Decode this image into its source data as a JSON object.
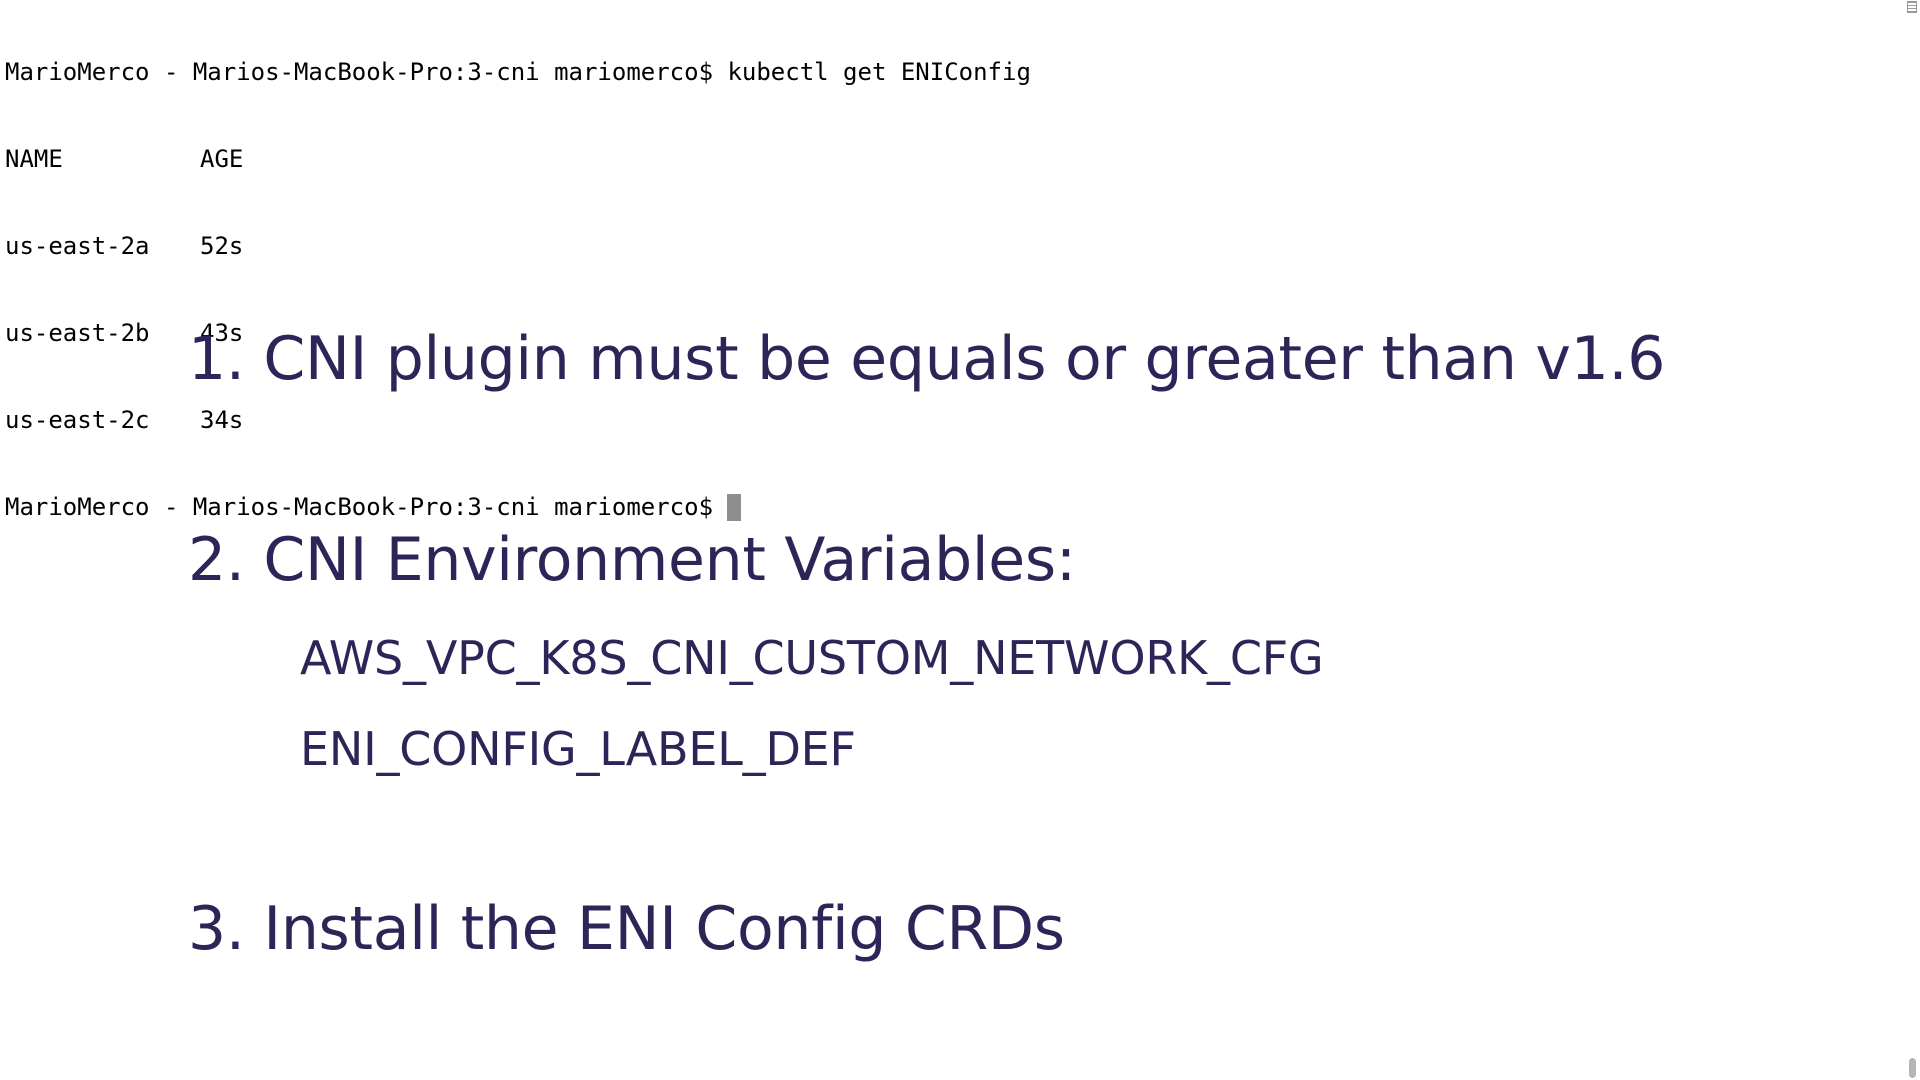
{
  "terminal": {
    "lines": [
      {
        "text": "MarioMerco - Marios-MacBook-Pro:3-cni mariomerco$ kubectl get ENIConfig"
      },
      {
        "col1": "NAME",
        "col2": "AGE"
      },
      {
        "col1": "us-east-2a",
        "col2": "52s"
      },
      {
        "col1": "us-east-2b",
        "col2": "43s"
      },
      {
        "col1": "us-east-2c",
        "col2": "34s"
      },
      {
        "text": "MarioMerco - Marios-MacBook-Pro:3-cni mariomerco$"
      }
    ]
  },
  "slide": {
    "item1": "1. CNI plugin must be equals or greater than v1.6",
    "item2": "2. CNI Environment Variables:",
    "item2_sub1": "AWS_VPC_K8S_CNI_CUSTOM_NETWORK_CFG",
    "item2_sub2": "ENI_CONFIG_LABEL_DEF",
    "item3": "3. Install the ENI Config CRDs"
  },
  "colors": {
    "slide_text": "#2c2658",
    "terminal_text": "#000000",
    "cursor": "#8e8e8e",
    "background": "#ffffff"
  },
  "icons": {
    "scroll_top": "split-pane-icon",
    "scroll_thumb": "scroll-thumb"
  }
}
